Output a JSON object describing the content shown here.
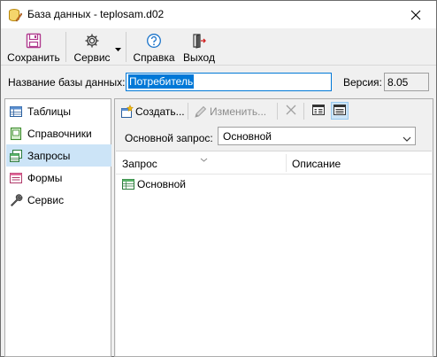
{
  "window": {
    "title": "База данных - teplosam.d02",
    "title_icon": "database-pencil-icon",
    "close_icon": "close-icon"
  },
  "toolbar": {
    "save_label": "Сохранить",
    "service_label": "Сервис",
    "help_label": "Справка",
    "exit_label": "Выход"
  },
  "dbname": {
    "label": "Название базы данных:",
    "value": "Потребитель",
    "version_label": "Версия:",
    "version_value": "8.05"
  },
  "sidebar": {
    "items": [
      {
        "label": "Таблицы",
        "icon": "table-icon",
        "active": false
      },
      {
        "label": "Справочники",
        "icon": "reference-book-icon",
        "active": false
      },
      {
        "label": "Запросы",
        "icon": "query-icon",
        "active": true
      },
      {
        "label": "Формы",
        "icon": "form-icon",
        "active": false
      },
      {
        "label": "Сервис",
        "icon": "wrench-icon",
        "active": false
      }
    ]
  },
  "subtoolbar": {
    "create_label": "Создать...",
    "edit_label": "Изменить...",
    "delete_icon": "delete-x-icon",
    "view_details_icon": "details-view-icon",
    "view_list_icon": "list-view-icon"
  },
  "main_query": {
    "label": "Основной запрос:",
    "selected": "Основной"
  },
  "list": {
    "columns": [
      "Запрос",
      "Описание"
    ],
    "rows": [
      {
        "name": "Основной",
        "description": ""
      }
    ]
  },
  "colors": {
    "accent": "#0078d7",
    "selection_bg": "#cce4f7",
    "window_bg": "#f0f0f0"
  }
}
